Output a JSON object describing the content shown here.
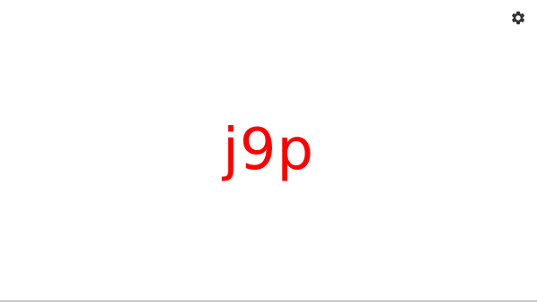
{
  "settings": {
    "icon": "gear-icon",
    "icon_color": "#333333"
  },
  "display": {
    "text": "j9p",
    "color": "#ff0000"
  }
}
